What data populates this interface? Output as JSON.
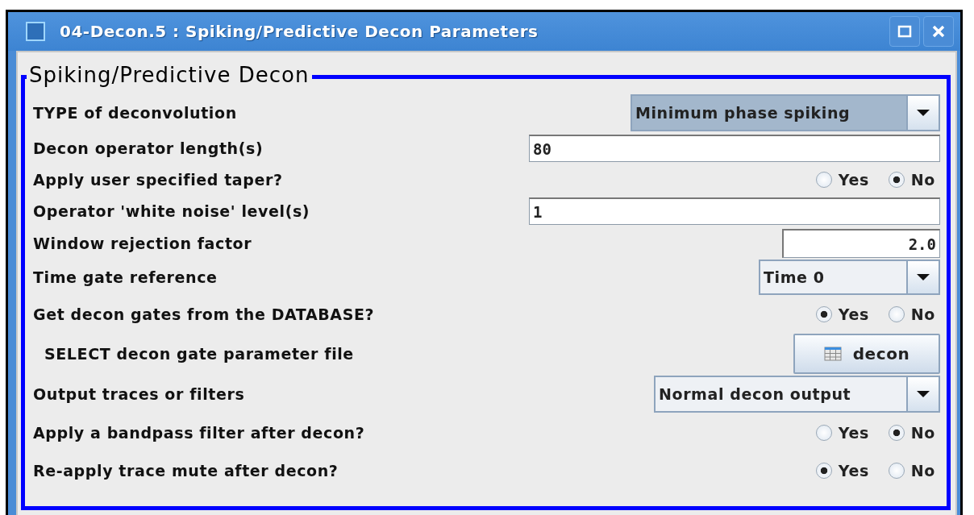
{
  "window": {
    "title": "04-Decon.5 : Spiking/Predictive Decon Parameters"
  },
  "group": {
    "title": "Spiking/Predictive Decon"
  },
  "rows": [
    {
      "kind": "combo",
      "label": "TYPE of deconvolution",
      "value": "Minimum phase spiking",
      "highlighted": true
    },
    {
      "kind": "text",
      "label": "Decon operator length(s)",
      "value": "80"
    },
    {
      "kind": "radio",
      "label": "Apply user specified taper?",
      "options": [
        {
          "label": "Yes",
          "selected": false
        },
        {
          "label": "No",
          "selected": true
        }
      ]
    },
    {
      "kind": "text",
      "label": "Operator 'white noise' level(s)",
      "value": "1"
    },
    {
      "kind": "text",
      "label": "Window rejection factor",
      "value": "2.0"
    },
    {
      "kind": "combo",
      "label": "Time gate reference",
      "value": "Time 0",
      "highlighted": false
    },
    {
      "kind": "radio",
      "label": "Get decon gates from the DATABASE?",
      "options": [
        {
          "label": "Yes",
          "selected": true
        },
        {
          "label": "No",
          "selected": false
        }
      ]
    },
    {
      "kind": "button",
      "label": "SELECT decon gate parameter file",
      "value": "decon"
    },
    {
      "kind": "combo",
      "label": "Output traces or filters",
      "value": "Normal decon output",
      "highlighted": false
    },
    {
      "kind": "radio",
      "label": "Apply a bandpass filter after decon?",
      "options": [
        {
          "label": "Yes",
          "selected": false
        },
        {
          "label": "No",
          "selected": true
        }
      ]
    },
    {
      "kind": "radio",
      "label": "Re-apply trace mute after decon?",
      "options": [
        {
          "label": "Yes",
          "selected": true
        },
        {
          "label": "No",
          "selected": false
        }
      ]
    }
  ]
}
